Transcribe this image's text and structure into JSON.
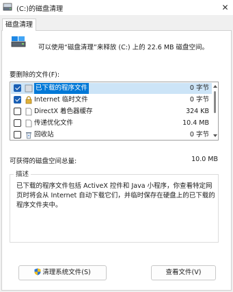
{
  "window": {
    "title": "(C:)的磁盘清理"
  },
  "tab": {
    "label": "磁盘清理"
  },
  "summary": {
    "text": "可以使用“磁盘清理”来释放  (C:) 上的 22.6 MB 磁盘空间。"
  },
  "files": {
    "label": "要删除的文件(F):",
    "items": [
      {
        "name": "已下载的程序文件",
        "size": "0 字节",
        "checked": true,
        "selected": true,
        "icon": "folder-icon"
      },
      {
        "name": "Internet 临时文件",
        "size": "0 字节",
        "checked": true,
        "selected": false,
        "icon": "lock-icon"
      },
      {
        "name": "DirectX 着色器缓存",
        "size": "324 KB",
        "checked": false,
        "selected": false,
        "icon": "file-icon"
      },
      {
        "name": "传递优化文件",
        "size": "10.4 MB",
        "checked": false,
        "selected": false,
        "icon": "file-icon"
      },
      {
        "name": "回收站",
        "size": "0 字节",
        "checked": false,
        "selected": false,
        "icon": "recycle-bin-icon"
      }
    ]
  },
  "space": {
    "label": "可获得的磁盘空间总量:",
    "value": "10.0 MB"
  },
  "description": {
    "title": "描述",
    "text": "已下载的程序文件包括 ActiveX 控件和 Java 小程序，你查看特定网页时将会从 Internet 自动下载它们，并临时保存在硬盘上的已下载的程序文件夹中。"
  },
  "buttons": {
    "clean_system": "清理系统文件(S)",
    "view_files": "查看文件(V)"
  },
  "colors": {
    "selection": "#0078d7",
    "checkbox": "#1a5fb4"
  }
}
